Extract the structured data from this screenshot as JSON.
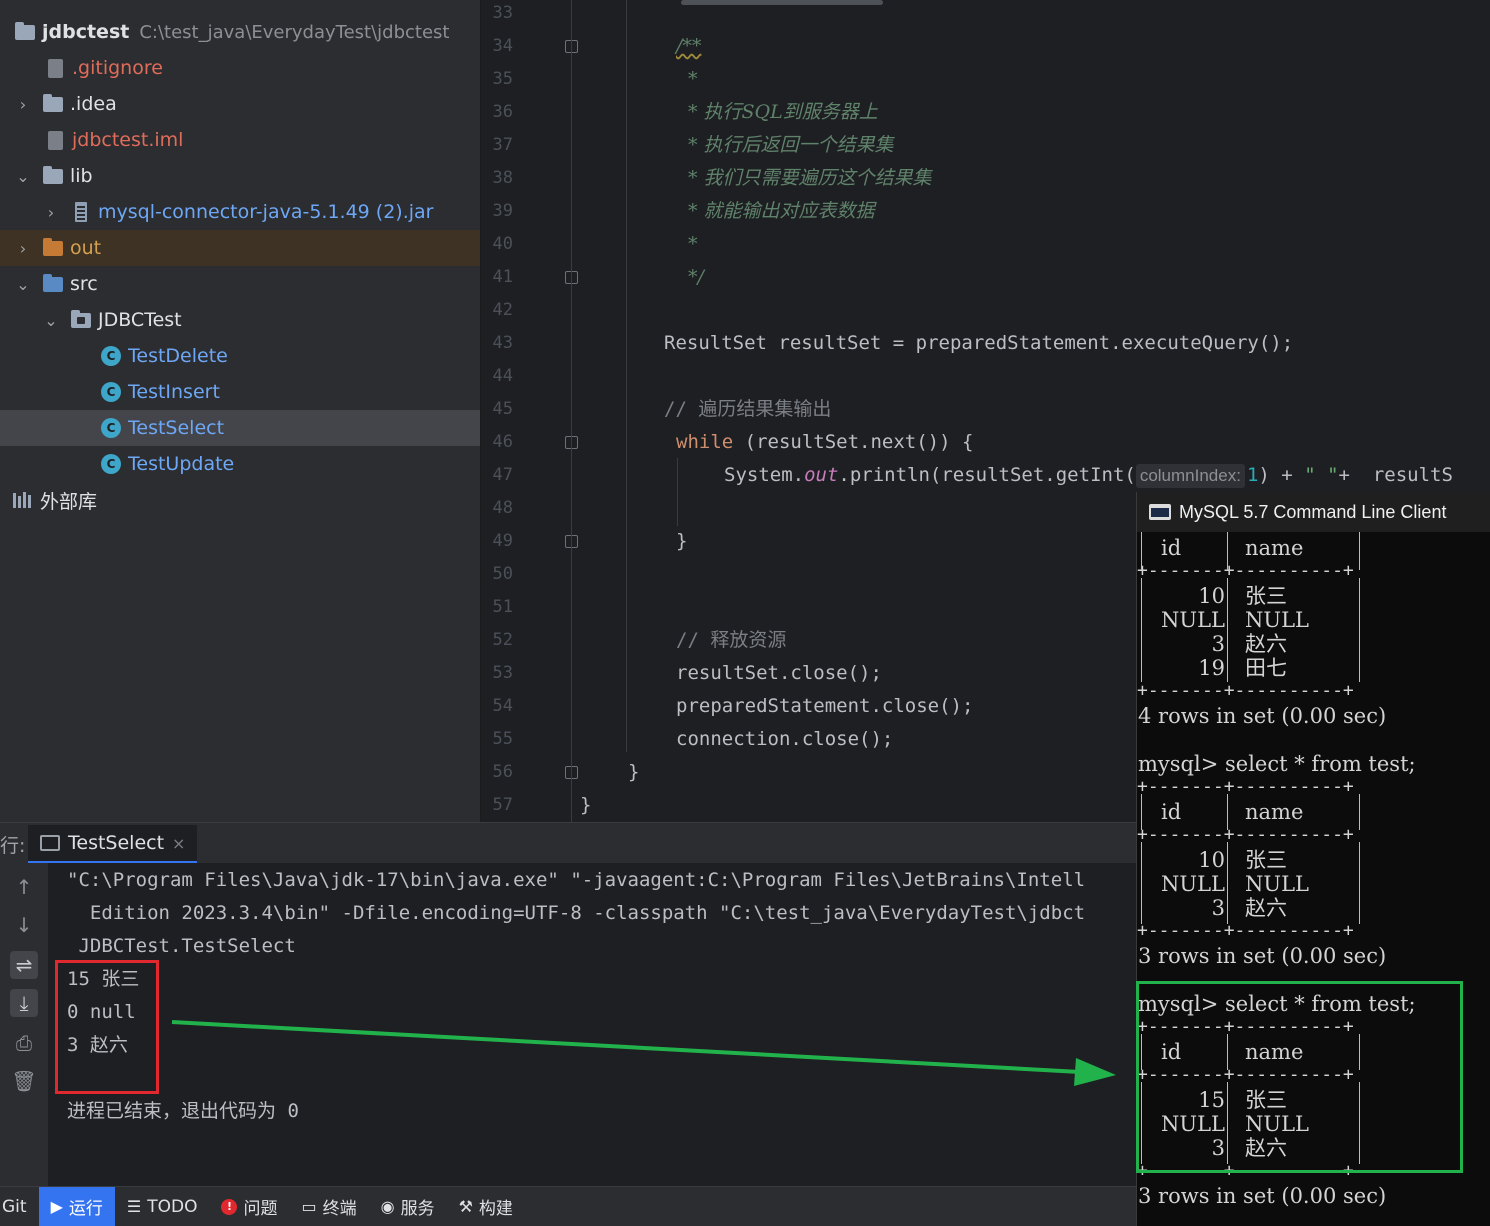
{
  "tree": {
    "project": {
      "name": "jdbctest",
      "path": "C:\\test_java\\EverydayTest\\jdbctest"
    },
    "items": [
      {
        "label": ".gitignore"
      },
      {
        "label": ".idea"
      },
      {
        "label": "jdbctest.iml"
      },
      {
        "label": "lib"
      },
      {
        "label": "mysql-connector-java-5.1.49 (2).jar"
      },
      {
        "label": "out"
      },
      {
        "label": "src"
      },
      {
        "label": "JDBCTest"
      },
      {
        "label": "TestDelete"
      },
      {
        "label": "TestInsert"
      },
      {
        "label": "TestSelect"
      },
      {
        "label": "TestUpdate"
      },
      {
        "label": "外部库"
      }
    ],
    "class_icon_letter": "C"
  },
  "editor": {
    "line_numbers": [
      "33",
      "34",
      "35",
      "36",
      "37",
      "38",
      "39",
      "40",
      "41",
      "42",
      "43",
      "44",
      "45",
      "46",
      "47",
      "48",
      "49",
      "50",
      "51",
      "52",
      "53",
      "54",
      "55",
      "56",
      "57"
    ],
    "code": {
      "l34": "/**",
      "l35": "*",
      "l36": "* 执行SQL到服务器上",
      "l37": "* 执行后返回一个结果集",
      "l38": "* 我们只需要遍历这个结果集",
      "l39": "* 就能输出对应表数据",
      "l40": "*",
      "l41": "*/",
      "l43": "ResultSet resultSet = preparedStatement.executeQuery();",
      "l45": "// 遍历结果集输出",
      "l46_kw": "while",
      "l46_rest": " (resultSet.next()) {",
      "l47_a": "System.",
      "l47_field": "out",
      "l47_b": ".println(resultSet.getInt(",
      "l47_hint": "columnIndex:",
      "l47_num": "1",
      "l47_c": ") +",
      "l47_str": "\" \"",
      "l47_d": "+  resultS",
      "l49": "}",
      "l52": "// 释放资源",
      "l53": "resultSet.close();",
      "l54": "preparedStatement.close();",
      "l55": "connection.close();",
      "l56": "}",
      "l57": "}"
    }
  },
  "run": {
    "label": "行:",
    "tab": "TestSelect",
    "tab_close": "×",
    "output": [
      "\"C:\\Program Files\\Java\\jdk-17\\bin\\java.exe\" \"-javaagent:C:\\Program Files\\JetBrains\\Intell",
      "  Edition 2023.3.4\\bin\" -Dfile.encoding=UTF-8 -classpath \"C:\\test_java\\EverydayTest\\jdbct",
      " JDBCTest.TestSelect",
      "15 张三",
      "0 null",
      "3 赵六",
      "",
      "进程已结束，退出代码为 0"
    ]
  },
  "bottombar": [
    {
      "label": "Git"
    },
    {
      "label": "运行"
    },
    {
      "label": "TODO"
    },
    {
      "label": "问题"
    },
    {
      "label": "终端"
    },
    {
      "label": "服务"
    },
    {
      "label": "构建"
    }
  ],
  "mysql": {
    "title": "MySQL 5.7 Command Line Client",
    "header": {
      "id": "id",
      "name": "name"
    },
    "border": "+-------+----------+",
    "table1": {
      "ids": [
        "10",
        "NULL",
        "3",
        "19"
      ],
      "names": [
        "张三",
        "NULL",
        "赵六",
        "田七"
      ],
      "footer": "4 rows in set (0.00 sec)"
    },
    "prompt": "mysql> select * from test;",
    "table2": {
      "ids": [
        "10",
        "NULL",
        "3"
      ],
      "names": [
        "张三",
        "NULL",
        "赵六"
      ],
      "footer": "3 rows in set (0.00 sec)"
    },
    "table3": {
      "ids": [
        "15",
        "NULL",
        "3"
      ],
      "names": [
        "张三",
        "NULL",
        "赵六"
      ],
      "footer": "3 rows in set (0.00 sec)"
    }
  },
  "colors": {
    "highlight_red": "#e0282e",
    "highlight_green": "#21b24b",
    "accent": "#3574f0"
  }
}
